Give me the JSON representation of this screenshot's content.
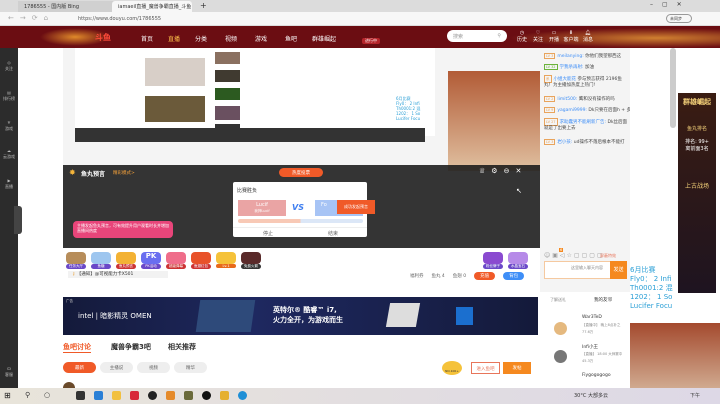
{
  "browser": {
    "tabs": [
      {
        "label": "1786555 - 国内版 Bing"
      },
      {
        "label": "iamaeil直播_魔兽争霸直播_斗鱼"
      }
    ],
    "url": "https://www.douyu.com/1786555",
    "profile_label": "未同步"
  },
  "header": {
    "logo": "斗鱼",
    "nav": [
      "首页",
      "直播",
      "分类",
      "视频",
      "游戏",
      "鱼吧",
      "群雄崛起"
    ],
    "promo": "进行中",
    "search_placeholder": "搜索",
    "icons": [
      {
        "label": "历史",
        "icon": "clock-icon"
      },
      {
        "label": "关注",
        "icon": "heart-icon"
      },
      {
        "label": "开播",
        "icon": "camera-icon"
      },
      {
        "label": "客户端",
        "icon": "download-icon"
      },
      {
        "label": "消息",
        "icon": "bell-icon"
      }
    ]
  },
  "sidebar": {
    "items": [
      "关注",
      "排行榜",
      "游戏",
      "云游戏",
      "直播"
    ],
    "bottom": "客服"
  },
  "prediction": {
    "title": "鱼丸预言",
    "mode": "精彩模式>",
    "top_button": "热度投票",
    "dialog_title": "比赛胜负",
    "left": "Lucif",
    "left_sub": "我押Lucif",
    "vs": "VS",
    "right": "Fo",
    "success": "成功发起预言",
    "stop": "停止",
    "end": "结束",
    "tooltip": "主播发起鱼丸预言，可有效提升用户观看时长并增加直播间热度"
  },
  "gifts": [
    "任务大厅",
    "鱼糖",
    "鱼丸预言",
    "PK活动",
    "超级弹幕",
    "鱼翅红包",
    "Lv.1",
    "免费火箭"
  ],
  "gift_right": [
    "粉丝牌子",
    "水晶宝石"
  ],
  "notice": "【通知】@可视能力卡X501",
  "room_info": {
    "rank": "福利券",
    "fishball": "鱼丸 4",
    "fish": "鱼翅 0",
    "recharge": "充值",
    "pack": "背包"
  },
  "chat": {
    "messages": [
      {
        "lv": "LV 3",
        "user": "meilanying:",
        "text": "你他们我望那西这"
      },
      {
        "lv": "LV 32",
        "user": "学我杀再射:",
        "text": "加油"
      },
      {
        "lv": "系",
        "user": "小姐大能花",
        "text": "参与预言获得 2196鱼丸！为主播加热度上热门!"
      },
      {
        "lv": "LV 2",
        "user": "limit500:",
        "text": "鹰和没有操作的吗"
      },
      {
        "lv": "LV 9",
        "user": "yagami9999:",
        "text": "Dk只要在后面h + 多c就行了"
      },
      {
        "lv": "LV 27",
        "user": "求助蠢男不能刷新广告:",
        "text": "Dk丝后面就是了出要上去"
      },
      {
        "lv": "LV 3",
        "user": "岩小孩:",
        "text": "ud操作不落后根本不能打"
      }
    ],
    "input_placeholder": "这里输入聊天内容",
    "send": "发送",
    "danmu": "屏蔽特效",
    "badge": "6"
  },
  "friends": {
    "tab1": "了解送礼",
    "tab2": "我的友邻",
    "refresh": "刷新",
    "list": [
      {
        "name": "War3TeD",
        "status": "【直播中】 晚上8点补之",
        "count": "77.6万"
      },
      {
        "name": "Infi小王",
        "status": "【直播】 18:00 大师赛中",
        "count": "45.3万"
      },
      {
        "name": "Fiygogogogo",
        "status": "",
        "count": ""
      }
    ]
  },
  "stream_overlay": [
    "6月比赛",
    "Fly0： 2 Infi",
    "Th0001:2  混",
    "1202： 1 So",
    "Lucifer Focu"
  ],
  "ad": {
    "label": "广告",
    "brand": "intel | 暗影精灵 OMEN",
    "slogan1": "英特尔® 酷睿™ i7,",
    "slogan2": "火力全开，为游戏而生"
  },
  "tabs": [
    "鱼吧讨论",
    "魔兽争霸3吧",
    "相关推荐"
  ],
  "filters": [
    "最新",
    "主播说",
    "视频",
    "精华"
  ],
  "actions": {
    "enter": "进入鱼吧",
    "post": "发帖",
    "rank": "NO.100+"
  },
  "right_ads": {
    "title1": "群雄崛起",
    "sub1": "鱼丸排名",
    "rank": "排名: 99+",
    "rank2": "离前面3名",
    "title2": "上古战场"
  },
  "taskbar": {
    "weather": "30°C 大部多云",
    "time": "下午"
  },
  "colors": {
    "header": "#6b0d12",
    "accent": "#f05a28",
    "blue": "#3e8ef7"
  }
}
